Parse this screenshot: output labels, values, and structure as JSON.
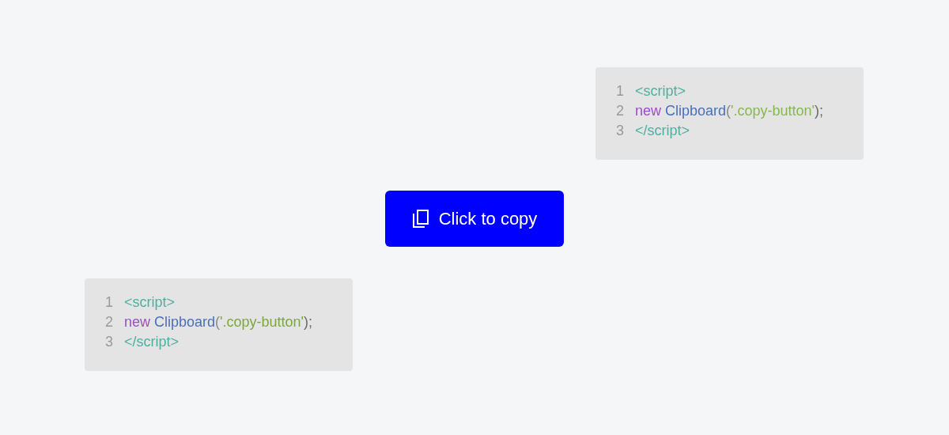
{
  "code_blocks": [
    {
      "lines": [
        {
          "number": "1",
          "tokens": [
            {
              "text": "<script>",
              "color": "#4cb0a0"
            }
          ]
        },
        {
          "number": "2",
          "tokens": [
            {
              "text": "new",
              "color": "#9a4fc4"
            },
            {
              "text": "Clipboard",
              "color": "#4a6fbb"
            },
            {
              "text": "(",
              "color": "#8a8a8a"
            },
            {
              "text": "'.copy-button'",
              "color": "#86b84e"
            },
            {
              "text": ");",
              "color": "#6a6a6a"
            }
          ]
        },
        {
          "number": "3",
          "tokens": [
            {
              "text": "</script>",
              "color": "#4cb0a0"
            }
          ]
        }
      ]
    },
    {
      "lines": [
        {
          "number": "1",
          "tokens": [
            {
              "text": "<script>",
              "color": "#4cb0a0"
            }
          ]
        },
        {
          "number": "2",
          "tokens": [
            {
              "text": "new",
              "color": "#9a4fc4"
            },
            {
              "text": "Clipboard",
              "color": "#4a6fbb"
            },
            {
              "text": "(",
              "color": "#8a8a8a"
            },
            {
              "text": "'.copy-button'",
              "color": "#7aa83c"
            },
            {
              "text": ");",
              "color": "#6a6a6a"
            }
          ]
        },
        {
          "number": "3",
          "tokens": [
            {
              "text": "</script>",
              "color": "#4cb0a0"
            }
          ]
        }
      ]
    }
  ],
  "copy_button": {
    "label": "Click to copy"
  }
}
